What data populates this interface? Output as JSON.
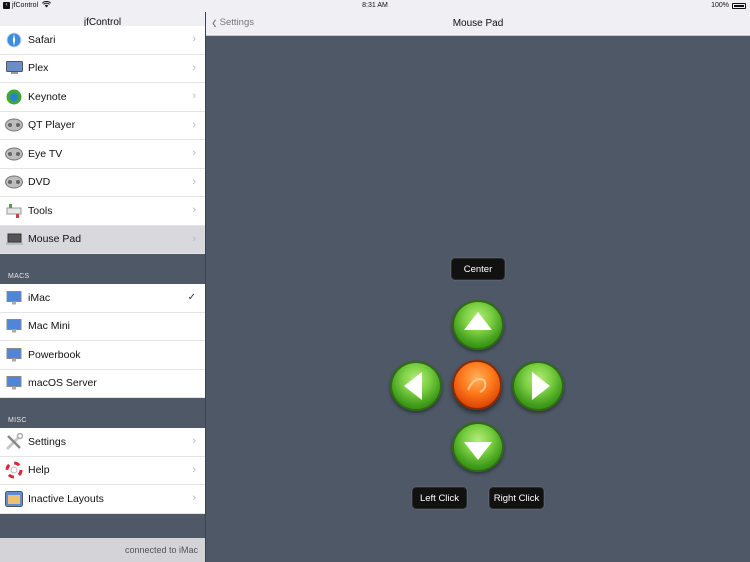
{
  "status_bar": {
    "back_app": "jfControl",
    "time": "8:31 AM",
    "battery": "100%"
  },
  "sidebar": {
    "title": "jfControl",
    "apps": [
      {
        "label": "Safari",
        "icon": "safari-icon"
      },
      {
        "label": "Plex",
        "icon": "plex-icon"
      },
      {
        "label": "Keynote",
        "icon": "keynote-icon"
      },
      {
        "label": "QT Player",
        "icon": "film-reel-icon"
      },
      {
        "label": "Eye TV",
        "icon": "film-reel-icon"
      },
      {
        "label": "DVD",
        "icon": "film-reel-icon"
      },
      {
        "label": "Tools",
        "icon": "tools-icon"
      },
      {
        "label": "Mouse Pad",
        "icon": "laptop-icon",
        "selected": true
      }
    ],
    "macs_header": "MACS",
    "macs": [
      {
        "label": "iMac",
        "icon": "imac-icon",
        "checked": true
      },
      {
        "label": "Mac Mini",
        "icon": "imac-icon"
      },
      {
        "label": "Powerbook",
        "icon": "imac-icon"
      },
      {
        "label": "macOS Server",
        "icon": "imac-icon"
      }
    ],
    "misc_header": "MISC",
    "misc": [
      {
        "label": "Settings",
        "icon": "wrench-screwdriver-icon"
      },
      {
        "label": "Help",
        "icon": "lifebuoy-icon"
      },
      {
        "label": "Inactive Layouts",
        "icon": "layouts-icon"
      }
    ],
    "footer": "connected to iMac"
  },
  "navbar": {
    "back_label": "Settings",
    "title": "Mouse Pad"
  },
  "pad": {
    "center_label": "Center",
    "left_click_label": "Left Click",
    "right_click_label": "Right Click"
  },
  "colors": {
    "background": "#4e5866",
    "green_button": "#5cbf2a",
    "orange_button": "#ff6a10",
    "selected_row": "#d9d9dd"
  }
}
